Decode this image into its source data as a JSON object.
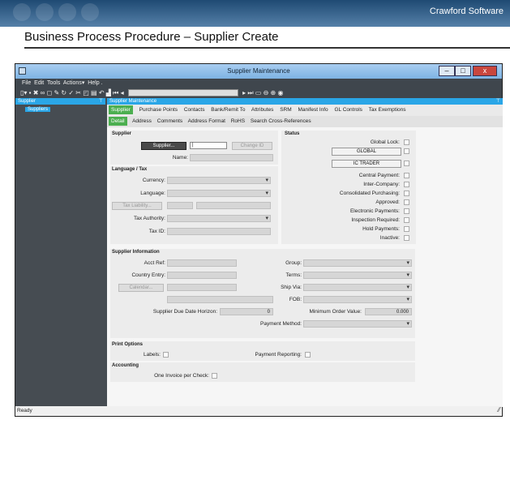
{
  "slide": {
    "brand": "Crawford Software",
    "title": "Business Process Procedure – Supplier Create"
  },
  "window": {
    "title": "Supplier Maintenance",
    "minimize": "–",
    "restore": "□",
    "close": "x"
  },
  "menu": [
    "File",
    "Edit",
    "Tools",
    "Actions▾",
    "Help ."
  ],
  "left_panel": {
    "header": "Supplier",
    "tree_item": "Suppliers"
  },
  "right_panel": {
    "header": "Supplier Maintenance"
  },
  "tabs_main": [
    "Supplier",
    "Purchase Points",
    "Contacts",
    "Bank/Remit To",
    "Attributes",
    "SRM",
    "Manifest Info",
    "GL Controls",
    "Tax Exemptions"
  ],
  "tabs_sub": [
    "Detail",
    "Address",
    "Comments",
    "Address Format",
    "RoHS",
    "Search Cross-References"
  ],
  "supplier": {
    "section": "Supplier",
    "supplier_button": "Supplier...",
    "supplier_value": "|",
    "change_id": "Change ID",
    "name_label": "Name:"
  },
  "lang_tax": {
    "section": "Language / Tax",
    "currency": "Currency:",
    "language": "Language:",
    "tax_liability": "Tax Liability...",
    "tax_authority": "Tax Authority:",
    "tax_id": "Tax ID:"
  },
  "status": {
    "section": "Status",
    "global_lock": "Global Lock:",
    "global_btn": "GLOBAL",
    "ic_trader": "IC TRADER",
    "checks": [
      "Central Payment:",
      "Inter-Company:",
      "Consolidated Purchasing:",
      "Approved:",
      "Electronic Payments:",
      "Inspection Required:",
      "Hold Payments:",
      "Inactive:"
    ]
  },
  "supplier_info": {
    "section": "Supplier Information",
    "acct_ref": "Acct Ref:",
    "country_entry": "Country Entry:",
    "calendar": "Calendar...",
    "due_horizon": "Supplier Due Date Horizon:",
    "due_horizon_value": "0",
    "group": "Group:",
    "terms": "Terms:",
    "ship_via": "Ship Via:",
    "fob": "FOB:",
    "min_order": "Minimum Order Value:",
    "min_order_value": "0.000",
    "payment_method": "Payment Method:"
  },
  "print_options": {
    "section": "Print Options",
    "labels": "Labels:",
    "payment_reporting": "Payment Reporting:"
  },
  "accounting": {
    "section": "Accounting",
    "one_invoice": "One Invoice per Check:"
  },
  "statusbar": {
    "text": "Ready"
  }
}
